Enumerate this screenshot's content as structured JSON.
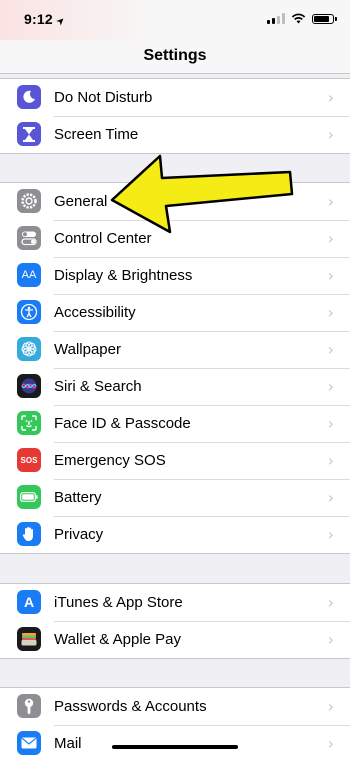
{
  "status_bar": {
    "time": "9:12",
    "location_arrow": "➤"
  },
  "nav": {
    "title": "Settings"
  },
  "sections": [
    {
      "rows": [
        {
          "label": "Do Not Disturb",
          "icon": "moon-icon",
          "color": "#5856d6"
        },
        {
          "label": "Screen Time",
          "icon": "hourglass-icon",
          "color": "#5856d6"
        }
      ]
    },
    {
      "rows": [
        {
          "label": "General",
          "icon": "gear-icon",
          "color": "#8e8e93"
        },
        {
          "label": "Control Center",
          "icon": "toggles-icon",
          "color": "#8e8e93"
        },
        {
          "label": "Display & Brightness",
          "icon": "text-size-icon",
          "glyph": "AA",
          "color": "#1a7cf5"
        },
        {
          "label": "Accessibility",
          "icon": "accessibility-icon",
          "color": "#1a7cf5"
        },
        {
          "label": "Wallpaper",
          "icon": "flower-icon",
          "color": "#35aadc"
        },
        {
          "label": "Siri & Search",
          "icon": "siri-icon",
          "color": "#1a1a1a"
        },
        {
          "label": "Face ID & Passcode",
          "icon": "face-id-icon",
          "color": "#34c759"
        },
        {
          "label": "Emergency SOS",
          "icon": "sos-icon",
          "glyph": "SOS",
          "color": "#e53935"
        },
        {
          "label": "Battery",
          "icon": "battery-icon",
          "color": "#34c759"
        },
        {
          "label": "Privacy",
          "icon": "hand-icon",
          "color": "#1a7cf5"
        }
      ]
    },
    {
      "rows": [
        {
          "label": "iTunes & App Store",
          "icon": "app-store-icon",
          "glyph": "A",
          "color": "#1a7cf5"
        },
        {
          "label": "Wallet & Apple Pay",
          "icon": "wallet-icon",
          "color": "#1a1a1a"
        }
      ]
    },
    {
      "rows": [
        {
          "label": "Passwords & Accounts",
          "icon": "key-icon",
          "color": "#8e8e93"
        },
        {
          "label": "Mail",
          "icon": "mail-icon",
          "color": "#1a7cf5"
        }
      ]
    }
  ],
  "chevron": "›",
  "arrow_color": "#f5ec16"
}
